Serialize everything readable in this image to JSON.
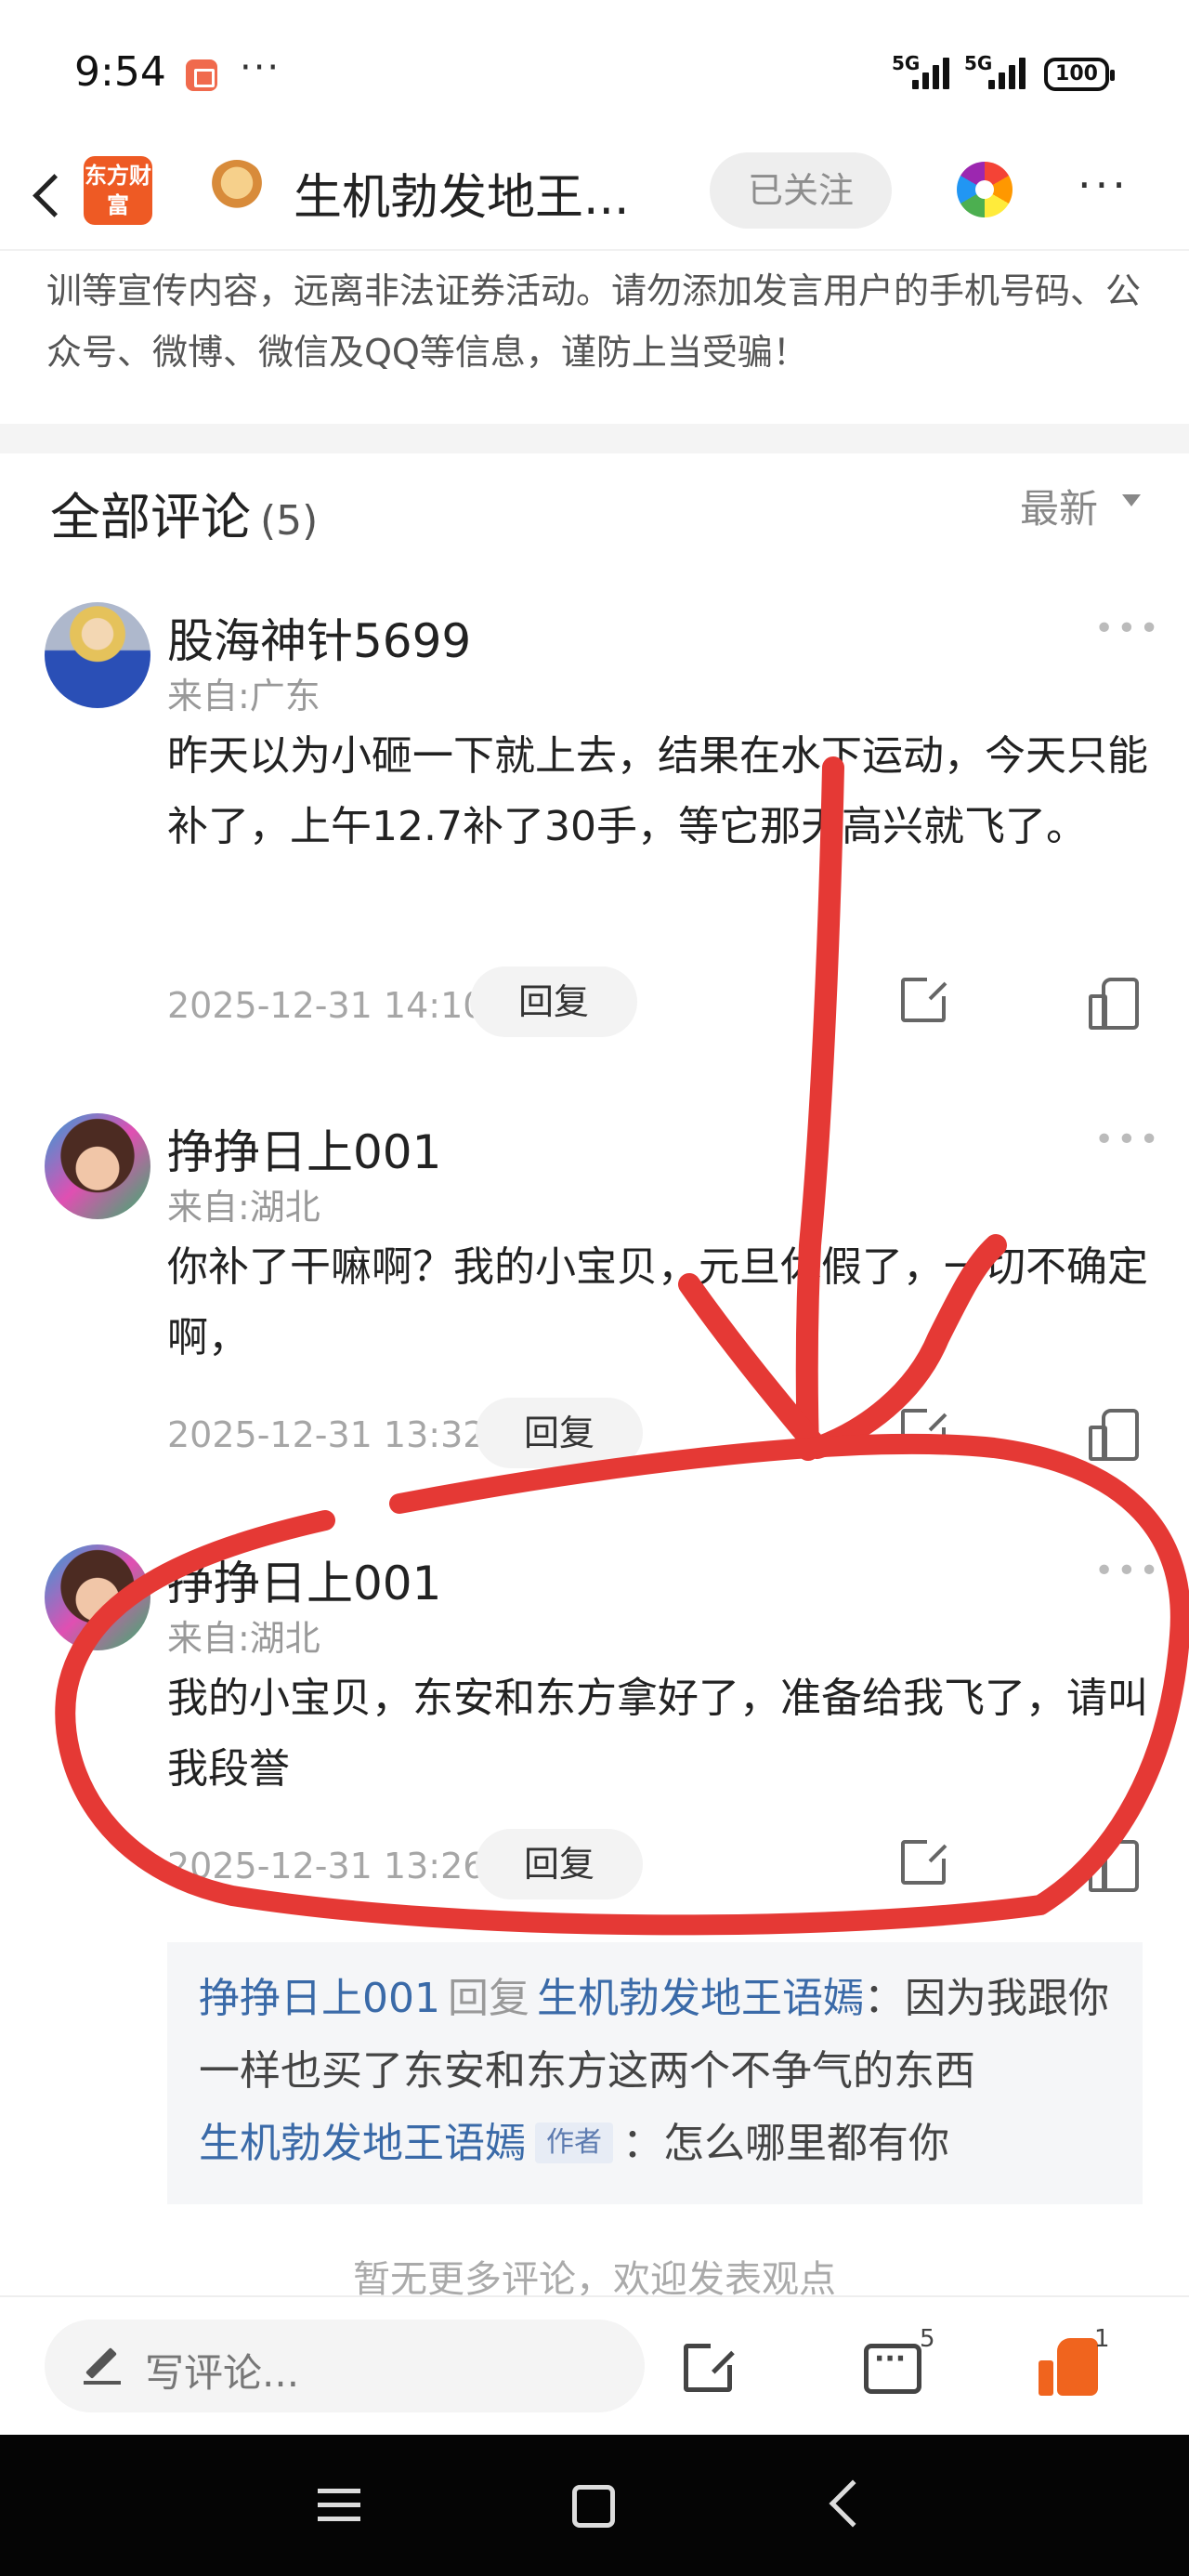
{
  "status_bar": {
    "time": "9:54",
    "dots": "···",
    "signal_1": "5G",
    "signal_2": "5G",
    "battery": "100"
  },
  "header": {
    "brand_logo": "东方财富",
    "title": "生机勃发地王...",
    "follow_label": "已关注",
    "more": "···"
  },
  "warning_text": "训等宣传内容，远离非法证券活动。请勿添加发言用户的手机号码、公众号、微博、微信及QQ等信息，谨防上当受骗！",
  "comments_section": {
    "title": "全部评论",
    "count": "(5)",
    "sort_label": "最新"
  },
  "comments": [
    {
      "username": "股海神针5699",
      "location": "来自:广东",
      "body": "昨天以为小砸一下就上去，结果在水下运动，今天只能补了，上午12.7补了30手，等它那天高兴就飞了。",
      "time": "2025-12-31 14:10",
      "reply_label": "回复"
    },
    {
      "username": "挣挣日上001",
      "location": "来自:湖北",
      "body": "你补了干嘛啊？我的小宝贝，元旦休假了，一切不确定啊，",
      "time": "2025-12-31 13:32",
      "reply_label": "回复"
    },
    {
      "username": "挣挣日上001",
      "location": "来自:湖北",
      "body": "我的小宝贝，东安和东方拿好了，准备给我飞了，请叫我段誉",
      "time": "2025-12-31 13:26",
      "reply_label": "回复"
    }
  ],
  "sub_replies": [
    {
      "from": "挣挣日上001",
      "reply_word": "回复",
      "to": "生机勃发地王语嫣",
      "text": "：因为我跟你一样也买了东安和东方这两个不争气的东西"
    },
    {
      "from": "生机勃发地王语嫣",
      "tag": "作者",
      "text": "：怎么哪里都有你"
    }
  ],
  "no_more_text": "暂无更多评论，欢迎发表观点",
  "bottom_bar": {
    "input_placeholder": "写评论...",
    "comment_count": "5",
    "like_count": "1"
  },
  "colors": {
    "brand": "#ee5a24",
    "link_blue": "#3a6aa8",
    "like_orange": "#f0641e",
    "annotation_red": "#e53935"
  },
  "icons": [
    "back-arrow-icon",
    "color-wheel-icon",
    "more-icon",
    "share-icon",
    "like-icon",
    "pen-icon",
    "comments-icon"
  ]
}
